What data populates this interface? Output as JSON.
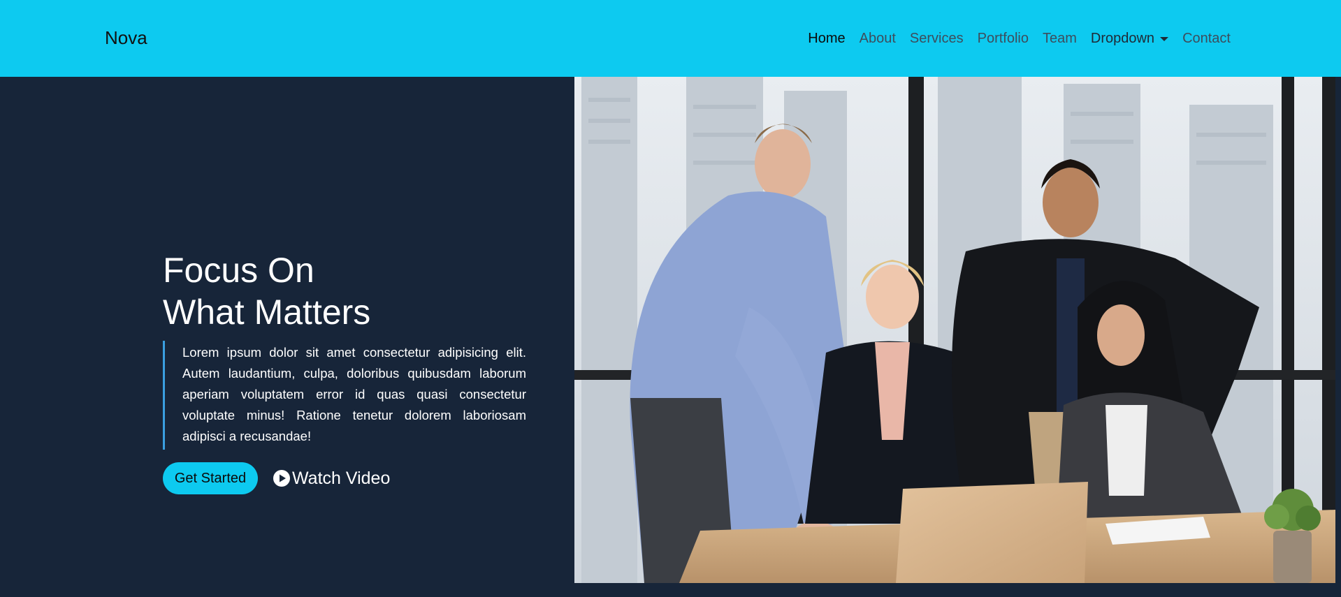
{
  "header": {
    "brand": "Nova",
    "nav": [
      {
        "label": "Home",
        "active": true
      },
      {
        "label": "About"
      },
      {
        "label": "Services"
      },
      {
        "label": "Portfolio"
      },
      {
        "label": "Team"
      },
      {
        "label": "Dropdown",
        "dropdown": true
      },
      {
        "label": "Contact"
      }
    ]
  },
  "hero": {
    "title_line1": "Focus On",
    "title_line2": "What Matters",
    "description": "Lorem ipsum dolor sit amet consectetur adipisicing elit. Autem laudantium, culpa, doloribus quibusdam laborum aperiam voluptatem error id quas quasi consectetur voluptate minus! Ratione tenetur dolorem laboriosam adipisci a recusandae!",
    "cta_primary": "Get Started",
    "cta_video": "Watch Video",
    "video_icon": "play-circle-icon",
    "image_subject": "team-meeting-photo"
  },
  "colors": {
    "header_bg": "#0dcaf0",
    "hero_bg": "#172539",
    "accent": "#0dcaf0",
    "quote_border": "#3a9fe0"
  }
}
